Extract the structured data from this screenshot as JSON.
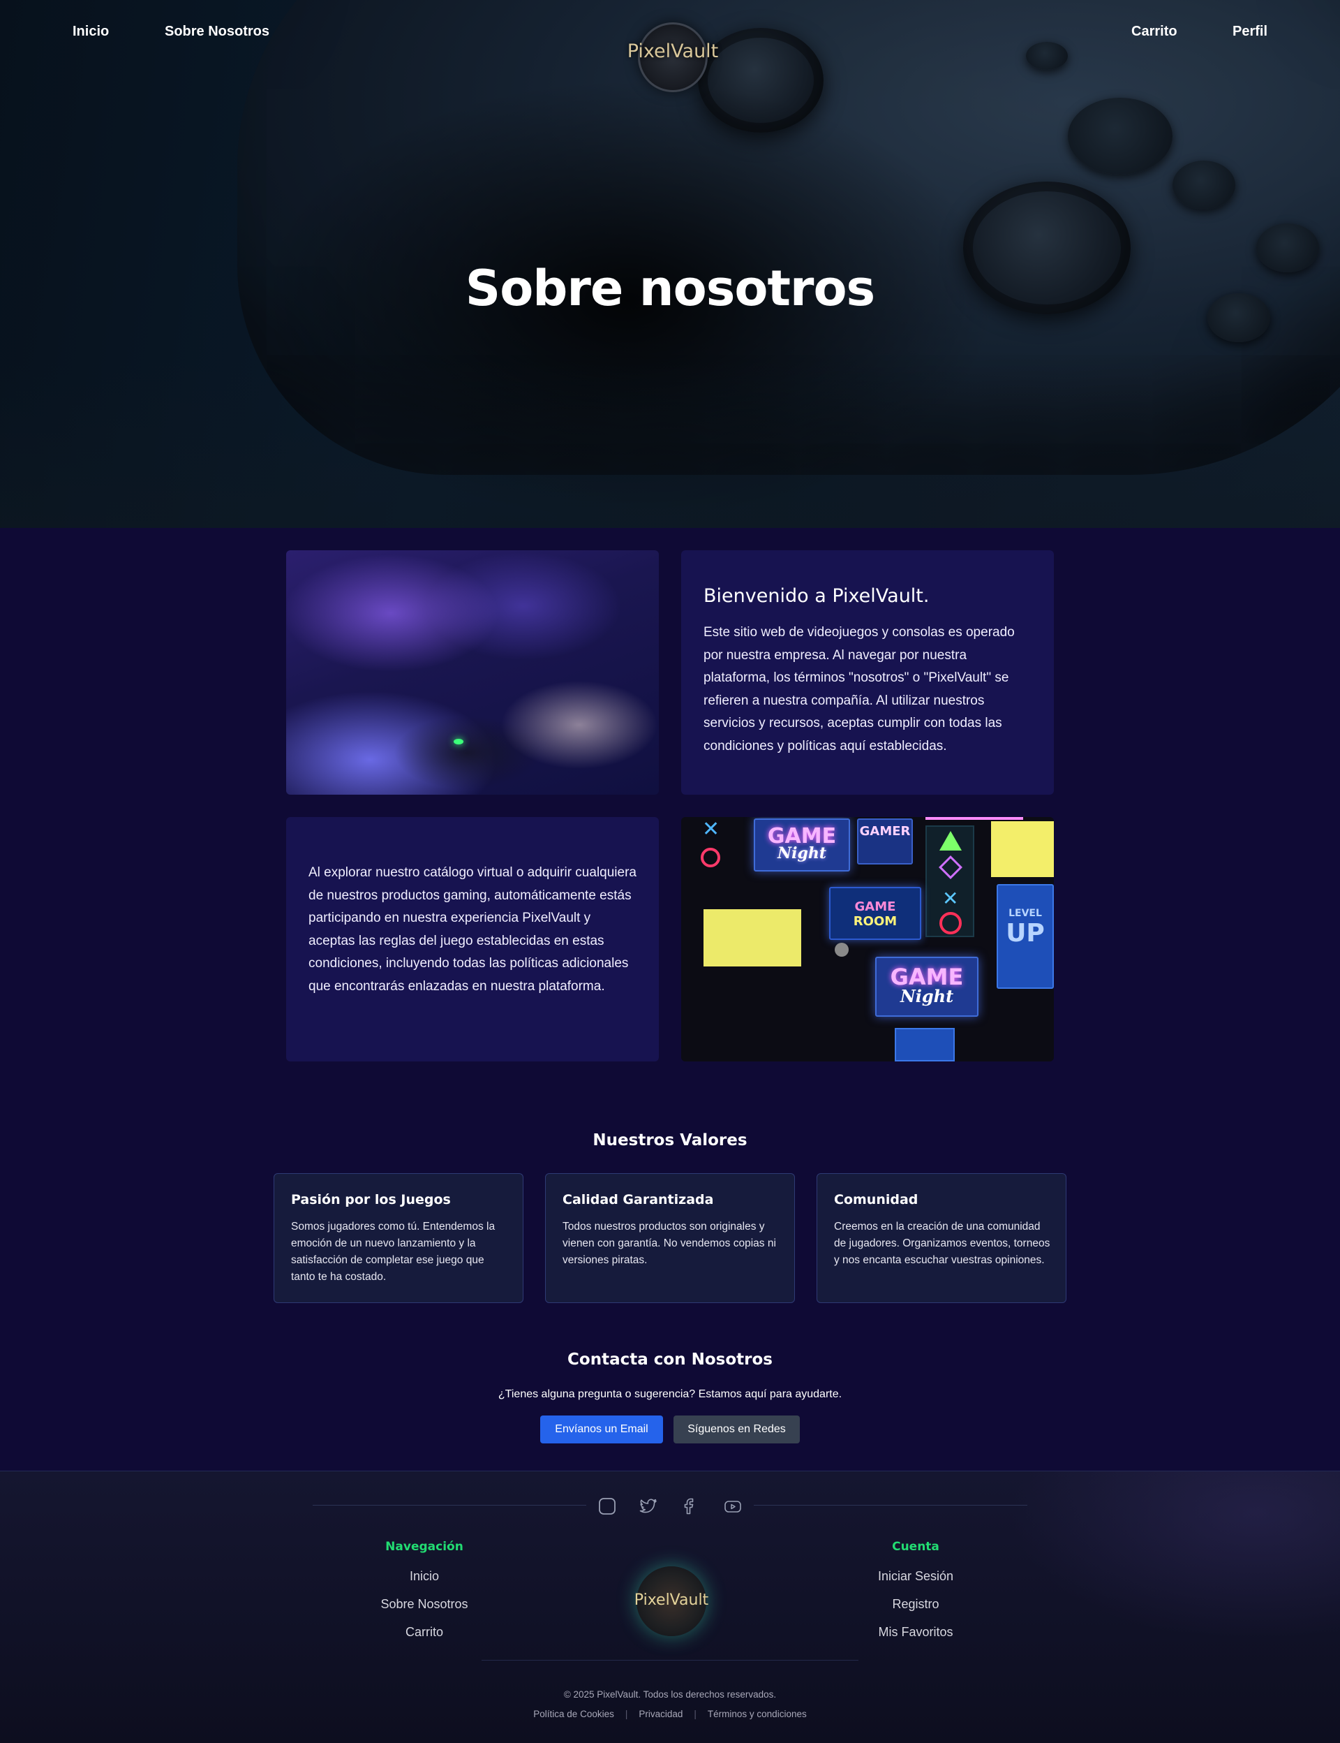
{
  "nav": {
    "left": [
      "Inicio",
      "Sobre Nosotros"
    ],
    "right": [
      "Carrito",
      "Perfil"
    ],
    "logo_text": "PixelVault"
  },
  "hero": {
    "title": "Sobre nosotros"
  },
  "about": {
    "welcome_heading": "Bienvenido a PixelVault.",
    "welcome_body": "Este sitio web de videojuegos y consolas es operado por nuestra empresa. Al navegar por nuestra plataforma, los términos \"nosotros\" o \"PixelVault\" se refieren a nuestra compañía. Al utilizar nuestros servicios y recursos, aceptas cumplir con todas las condiciones y políticas aquí establecidas.",
    "catalog_body": "Al explorar nuestro catálogo virtual o adquirir cualquiera de nuestros productos gaming, automáticamente estás participando en nuestra experiencia PixelVault y aceptas las reglas del juego establecidas en estas condiciones, incluyendo todas las políticas adicionales que encontrarás enlazadas en nuestra plataforma.",
    "neon_signs": [
      "GAME",
      "Night",
      "GAMER",
      "GAME",
      "ROOM",
      "GAME",
      "Night",
      "LEVEL",
      "UP"
    ]
  },
  "values": {
    "title": "Nuestros Valores",
    "cards": [
      {
        "title": "Pasión por los Juegos",
        "body": "Somos jugadores como tú. Entendemos la emoción de un nuevo lanzamiento y la satisfacción de completar ese juego que tanto te ha costado."
      },
      {
        "title": "Calidad Garantizada",
        "body": "Todos nuestros productos son originales y vienen con garantía. No vendemos copias ni versiones piratas."
      },
      {
        "title": "Comunidad",
        "body": "Creemos en la creación de una comunidad de jugadores. Organizamos eventos, torneos y nos encanta escuchar vuestras opiniones."
      }
    ]
  },
  "contact": {
    "title": "Contacta con Nosotros",
    "subtitle": "¿Tienes alguna pregunta o sugerencia? Estamos aquí para ayudarte.",
    "email_button": "Envíanos un Email",
    "social_button": "Síguenos en Redes"
  },
  "footer": {
    "social_icons": [
      "instagram-icon",
      "twitter-icon",
      "facebook-icon",
      "youtube-icon"
    ],
    "nav_title": "Navegación",
    "nav_links": [
      "Inicio",
      "Sobre Nosotros",
      "Carrito"
    ],
    "account_title": "Cuenta",
    "account_links": [
      "Iniciar Sesión",
      "Registro",
      "Mis Favoritos"
    ],
    "logo_text": "PixelVault",
    "copyright": "© 2025 PixelVault. Todos los derechos reservados.",
    "legal_links": [
      "Política de Cookies",
      "Privacidad",
      "Términos y condiciones"
    ]
  },
  "colors": {
    "page_bg": "#0f0a35",
    "panel_bg": "#171350",
    "card_bg": "#161b3c",
    "card_border": "#2e3a74",
    "primary_button": "#2563eb",
    "secondary_button": "#374151",
    "footer_accent": "#22dc72"
  }
}
